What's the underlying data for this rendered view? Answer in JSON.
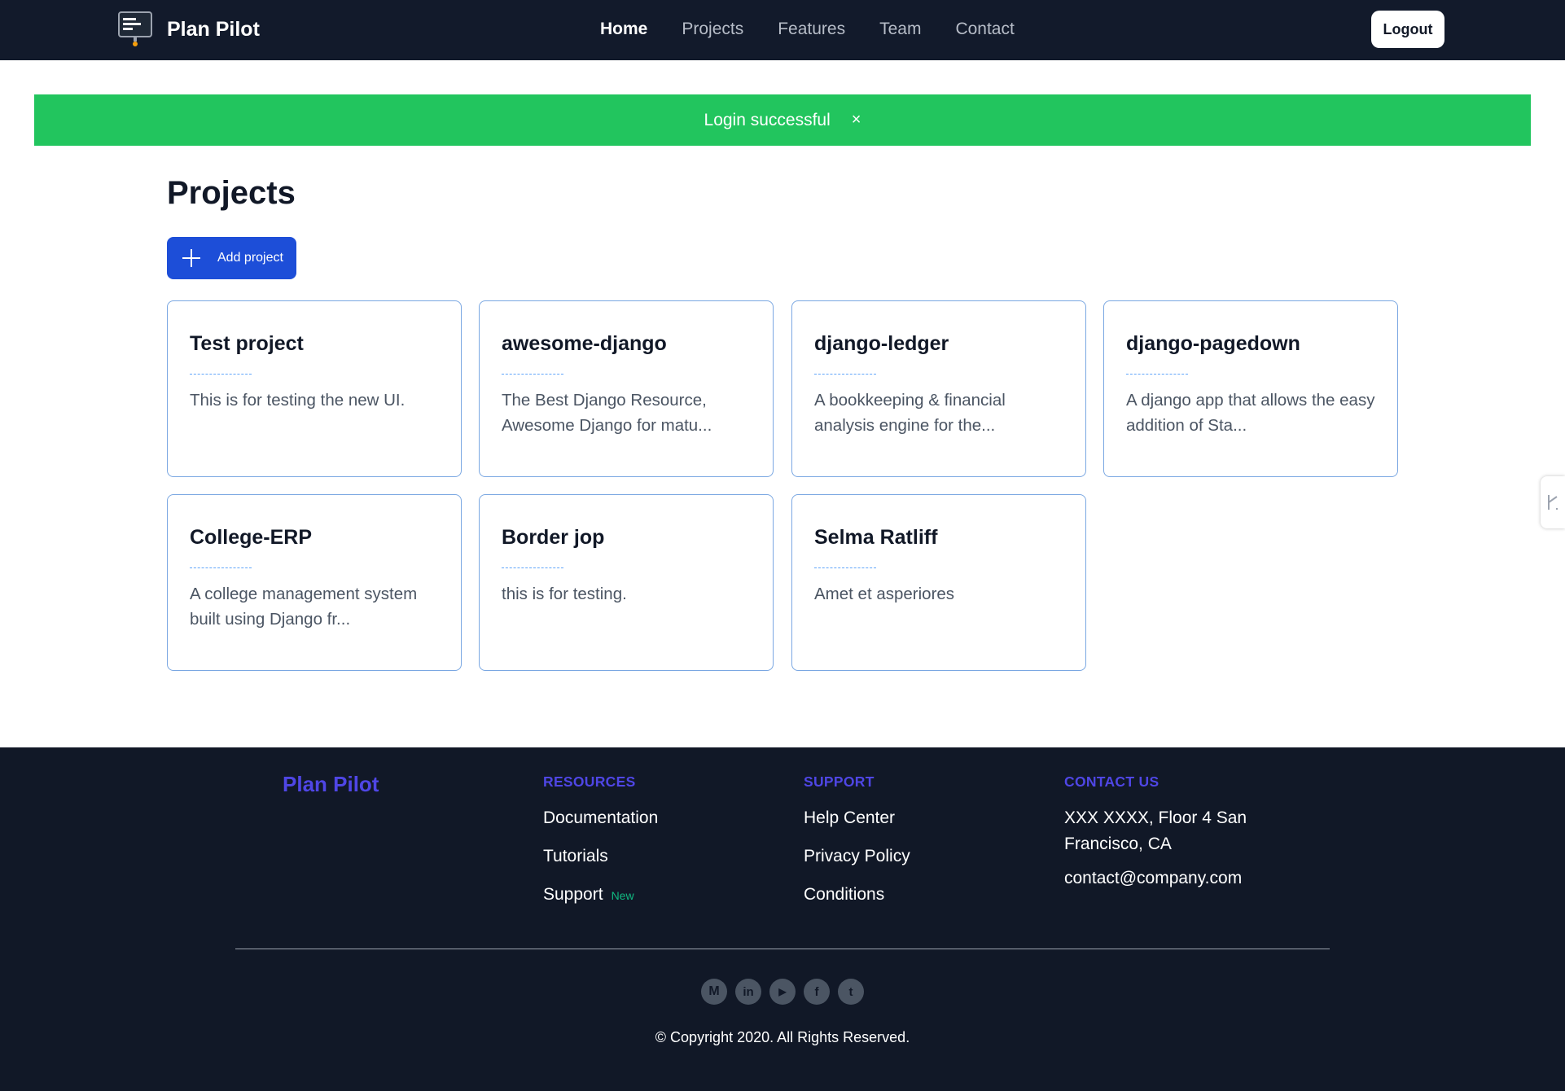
{
  "app": {
    "name": "Plan Pilot"
  },
  "nav": {
    "links": [
      {
        "label": "Home",
        "active": true
      },
      {
        "label": "Projects"
      },
      {
        "label": "Features"
      },
      {
        "label": "Team"
      },
      {
        "label": "Contact"
      }
    ],
    "logout_label": "Logout"
  },
  "alert": {
    "message": "Login successful",
    "close_symbol": "×",
    "color": "#22c55e"
  },
  "page": {
    "title": "Projects",
    "add_button_label": "Add project"
  },
  "projects": [
    {
      "title": "Test project",
      "description": "This is for testing the new UI."
    },
    {
      "title": "awesome-django",
      "description": "The Best Django Resource, Awesome Django for matu..."
    },
    {
      "title": "django-ledger",
      "description": "A bookkeeping & financial analysis engine for the..."
    },
    {
      "title": "django-pagedown",
      "description": "A django app that allows the easy addition of Sta..."
    },
    {
      "title": "College-ERP",
      "description": "A college management system built using Django fr..."
    },
    {
      "title": "Border jop",
      "description": "this is for testing."
    },
    {
      "title": "Selma Ratliff",
      "description": "Amet et asperiores"
    }
  ],
  "footer": {
    "brand": "Plan Pilot",
    "resources": {
      "heading": "RESOURCES",
      "items": [
        "Documentation",
        "Tutorials",
        "Support"
      ],
      "badge": "New"
    },
    "support": {
      "heading": "SUPPORT",
      "items": [
        "Help Center",
        "Privacy Policy",
        "Conditions"
      ]
    },
    "contact": {
      "heading": "CONTACT US",
      "address": "XXX XXXX, Floor 4 San Francisco, CA",
      "email": "contact@company.com"
    },
    "socials": [
      {
        "icon": "medium-icon",
        "glyph": "M"
      },
      {
        "icon": "linkedin-icon",
        "glyph": "in"
      },
      {
        "icon": "youtube-icon",
        "glyph": "▶"
      },
      {
        "icon": "facebook-icon",
        "glyph": "f"
      },
      {
        "icon": "twitter-icon",
        "glyph": "t"
      }
    ],
    "copyright": "© Copyright 2020. All Rights Reserved."
  },
  "colors": {
    "navbar": "#121a2b",
    "primary_button": "#1d4ed8",
    "footer_accent": "#4f46e5",
    "card_border": "#7aa7e2"
  }
}
